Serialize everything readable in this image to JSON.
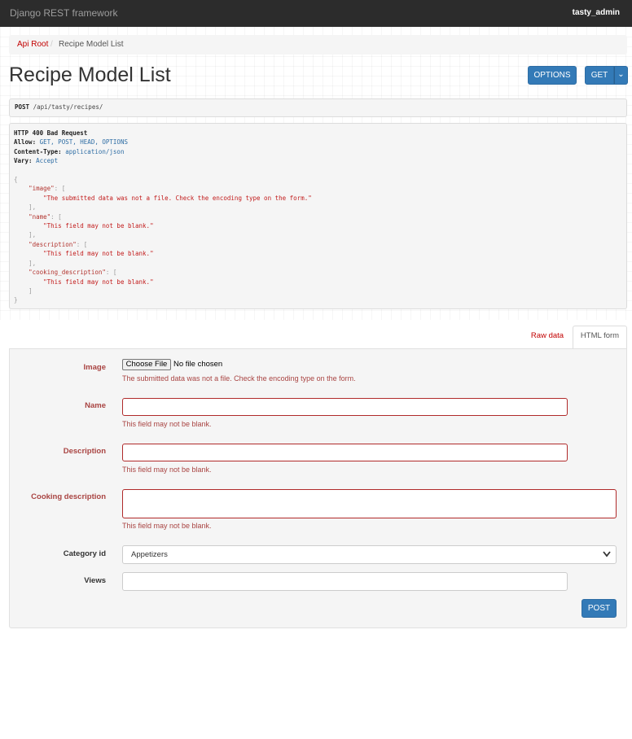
{
  "navbar": {
    "brand": "Django REST framework",
    "user": "tasty_admin"
  },
  "breadcrumb": {
    "root": "Api Root",
    "separator": "/",
    "current": "Recipe Model List"
  },
  "page": {
    "title": "Recipe Model List"
  },
  "buttons": {
    "options": "OPTIONS",
    "get": "GET",
    "caret": "⌄",
    "post": "POST"
  },
  "request": {
    "method": "POST",
    "path": " /api/tasty/recipes/"
  },
  "response": {
    "status": "HTTP 400 Bad Request",
    "allow_label": "Allow:",
    "allow_value": " GET, POST, HEAD, OPTIONS",
    "content_type_label": "Content-Type:",
    "content_type_value": " application/json",
    "vary_label": "Vary:",
    "vary_value": " Accept",
    "body": {
      "open": "{",
      "close": "}",
      "fields": [
        {
          "key": "\"image\"",
          "message": "\"The submitted data was not a file. Check the encoding type on the form.\""
        },
        {
          "key": "\"name\"",
          "message": "\"This field may not be blank.\""
        },
        {
          "key": "\"description\"",
          "message": "\"This field may not be blank.\""
        },
        {
          "key": "\"cooking_description\"",
          "message": "\"This field may not be blank.\""
        }
      ]
    }
  },
  "tabs": {
    "raw": "Raw data",
    "html": "HTML form"
  },
  "form": {
    "image": {
      "label": "Image",
      "button": "Choose File",
      "status": "No file chosen",
      "error": "The submitted data was not a file. Check the encoding type on the form."
    },
    "name": {
      "label": "Name",
      "value": "",
      "error": "This field may not be blank."
    },
    "description": {
      "label": "Description",
      "value": "",
      "error": "This field may not be blank."
    },
    "cooking_description": {
      "label": "Cooking description",
      "value": "",
      "error": "This field may not be blank."
    },
    "category_id": {
      "label": "Category id",
      "selected": "Appetizers"
    },
    "views": {
      "label": "Views",
      "value": ""
    }
  },
  "colors": {
    "navbar": "#2c2c2c",
    "primary": "#337ab7",
    "error": "#a94442",
    "link": "#c20000"
  },
  "icons": {
    "select_chevron": "chevron-down-icon"
  }
}
